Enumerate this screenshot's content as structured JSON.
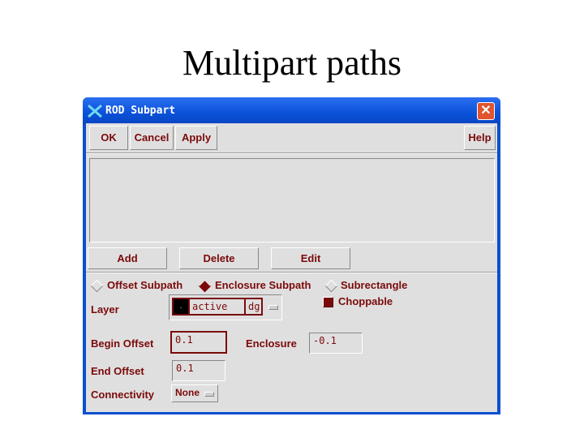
{
  "slide": {
    "title": "Multipart paths"
  },
  "window": {
    "title": "ROD Subpart",
    "close_label": "✕"
  },
  "toolbar": {
    "ok_label": "OK",
    "cancel_label": "Cancel",
    "apply_label": "Apply",
    "help_label": "Help"
  },
  "list_actions": {
    "add_label": "Add",
    "delete_label": "Delete",
    "edit_label": "Edit"
  },
  "subpart_type": {
    "options": [
      {
        "label": "Offset Subpath",
        "selected": false
      },
      {
        "label": "Enclosure Subpath",
        "selected": true
      },
      {
        "label": "Subrectangle",
        "selected": false
      }
    ]
  },
  "form": {
    "layer_label": "Layer",
    "layer_swatch_color": "#000000",
    "layer_name": "active",
    "layer_purpose": "dg",
    "choppable_label": "Choppable",
    "choppable_checked": true,
    "begin_offset_label": "Begin Offset",
    "begin_offset_value": "0.1",
    "enclosure_label": "Enclosure",
    "enclosure_value": "-0.1",
    "end_offset_label": "End Offset",
    "end_offset_value": "0.1",
    "connectivity_label": "Connectivity",
    "connectivity_value": "None"
  },
  "colors": {
    "accent_text": "#7a0a0a",
    "titlebar": "#0a50d8",
    "panel": "#e0dfe0"
  }
}
